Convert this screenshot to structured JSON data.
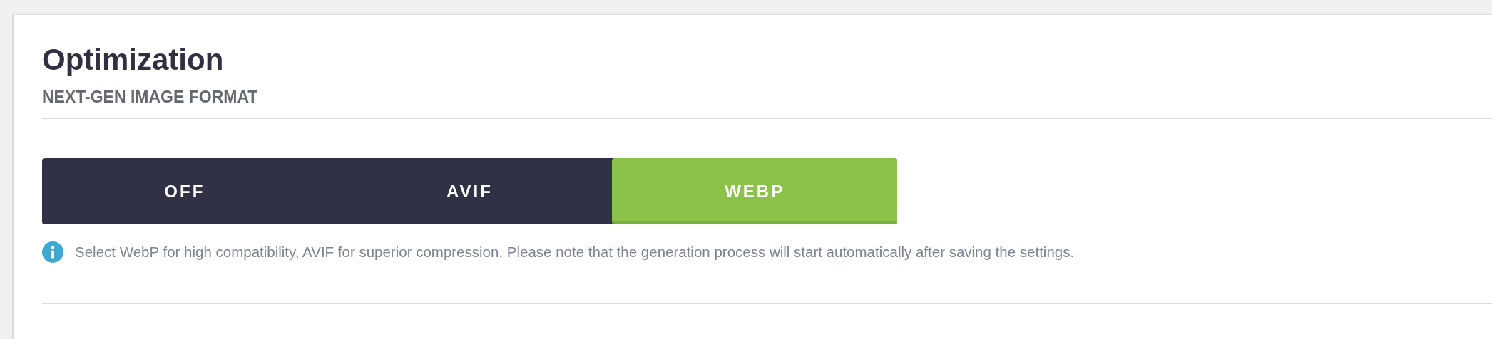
{
  "section": {
    "title": "Optimization",
    "subtitle": "NEXT-GEN IMAGE FORMAT"
  },
  "options": [
    {
      "label": "OFF",
      "selected": false
    },
    {
      "label": "AVIF",
      "selected": false
    },
    {
      "label": "WEBP",
      "selected": true
    }
  ],
  "help_text": "Select WebP for high compatibility, AVIF for superior compression. Please note that the generation process will start automatically after saving the settings."
}
